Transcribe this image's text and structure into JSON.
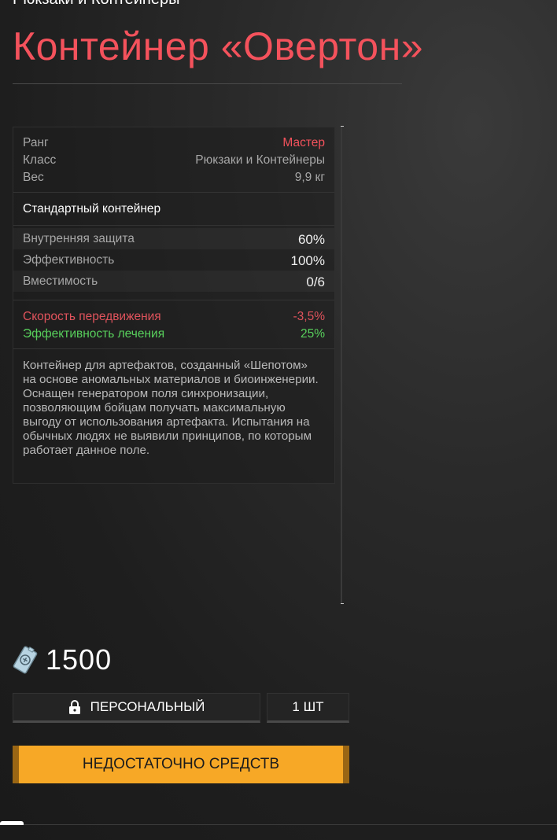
{
  "header": {
    "category": "Рюкзаки и Контейнеры",
    "title": "Контейнер «Овертон»"
  },
  "info": {
    "rank_label": "Ранг",
    "rank_value": "Мастер",
    "class_label": "Класс",
    "class_value": "Рюкзаки и Контейнеры",
    "weight_label": "Вес",
    "weight_value": "9,9 кг"
  },
  "subtitle": "Стандартный контейнер",
  "stats": {
    "protection_label": "Внутренняя защита",
    "protection_value": "60%",
    "efficiency_label": "Эффективность",
    "efficiency_value": "100%",
    "capacity_label": "Вместимость",
    "capacity_value": "0/6"
  },
  "effects": {
    "speed_label": "Скорость передвижения",
    "speed_value": "-3,5%",
    "healing_label": "Эффективность лечения",
    "healing_value": "25%"
  },
  "description": "Контейнер для артефактов, созданный «Шепотом» на основе аномальных материалов и биоинженерии. Оснащен генератором поля синхронизации, позволяющим бойцам получать максимальную выгоду от использования артефакта. Испытания на обычных людях не выявили принципов, по которым работает данное поле.",
  "price": {
    "icon": "coupon-icon",
    "value": "1500"
  },
  "actions": {
    "personal_icon": "lock-icon",
    "personal_label": "ПЕРСОНАЛЬНЫЙ",
    "quantity_label": "1 ШТ",
    "buy_label": "НЕДОСТАТОЧНО СРЕДСТВ"
  },
  "colors": {
    "accent_red": "#f4525c",
    "positive_green": "#58d05c",
    "buy_button": "#f7a826"
  }
}
